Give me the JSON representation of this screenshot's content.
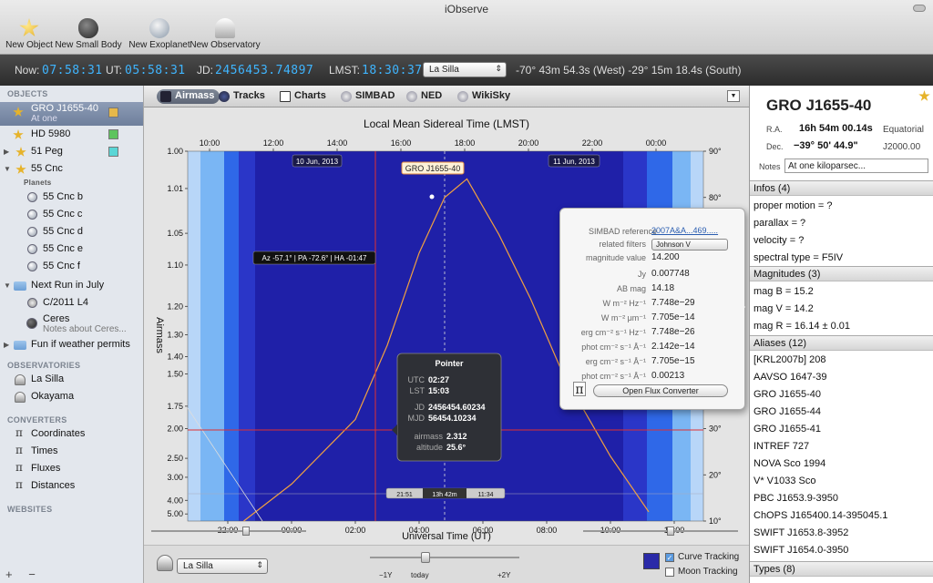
{
  "window": {
    "title": "iObserve"
  },
  "toolbar": {
    "new_object": "New Object",
    "new_small_body": "New Small Body",
    "new_exoplanet": "New Exoplanet",
    "new_observatory": "New Observatory"
  },
  "timebar": {
    "now_label": "Now:",
    "now_value": "07:58:31",
    "ut_label": "UT:",
    "ut_value": "05:58:31",
    "jd_label": "JD:",
    "jd_value": "2456453.74897",
    "lmst_label": "LMST:",
    "lmst_value": "18:30:37",
    "site": "La Silla",
    "site_coords": "-70° 43m 54.3s (West) -29° 15m 18.4s (South)"
  },
  "sidebar": {
    "objects_header": "OBJECTS",
    "selected": {
      "name": "GRO J1655-40",
      "subtitle": "At one"
    },
    "hd5980": "HD 5980",
    "peg51": "51 Peg",
    "cnc55": "55 Cnc",
    "planets_label": "Planets",
    "planets": [
      "55 Cnc b",
      "55 Cnc c",
      "55 Cnc d",
      "55 Cnc e",
      "55 Cnc f"
    ],
    "next_run": "Next Run in July",
    "c2011": "C/2011 L4",
    "ceres": "Ceres",
    "ceres_note": "Notes about Ceres...",
    "fun": "Fun if weather permits",
    "observatories_header": "OBSERVATORIES",
    "observatories": [
      "La Silla",
      "Okayama"
    ],
    "converters_header": "CONVERTERS",
    "converters": [
      "Coordinates",
      "Times",
      "Fluxes",
      "Distances"
    ],
    "websites_header": "WEBSITES",
    "add": "+",
    "remove": "−",
    "colors": {
      "gro": "#e6b84a",
      "hd": "#5ec45e",
      "peg": "#5ad6d6"
    }
  },
  "tabs": {
    "airmass": "Airmass",
    "tracks": "Tracks",
    "charts": "Charts",
    "simbad": "SIMBAD",
    "ned": "NED",
    "wikisky": "WikiSky",
    "menu": "▼"
  },
  "chart_data": {
    "type": "line",
    "title": "Local Mean Sidereal Time (LMST)",
    "xlabel": "Universal Time (UT)",
    "ylabel": "Airmass",
    "top_ticks": [
      "10:00",
      "12:00",
      "14:00",
      "16:00",
      "18:00",
      "20:00",
      "22:00",
      "00:00"
    ],
    "bottom_ticks": [
      "22:00",
      "00:00",
      "02:00",
      "04:00",
      "06:00",
      "08:00",
      "10:00",
      "12:00"
    ],
    "left_ticks": [
      "1.00",
      "1.01",
      "1.05",
      "1.10",
      "1.20",
      "1.30",
      "1.40",
      "1.50",
      "1.75",
      "2.00",
      "2.50",
      "3.00",
      "4.00",
      "5.00"
    ],
    "right_ticks": [
      "90°",
      "80°",
      "70°",
      "60°",
      "50°",
      "40°",
      "30°",
      "20°",
      "10°"
    ],
    "ylim": [
      10,
      90
    ],
    "series": [
      {
        "name": "GRO J1655-40",
        "color": "#f0a040",
        "x_hours": [
          22.5,
          0,
          2,
          3,
          4,
          4.8,
          5.5,
          6.5,
          7.5,
          8.5,
          10,
          11.2
        ],
        "altitude": [
          10,
          18,
          32,
          48,
          68,
          80,
          84,
          72,
          58,
          42,
          24,
          12
        ]
      }
    ],
    "date_labels": [
      "10 Jun, 2013",
      "11 Jun, 2013"
    ],
    "object_label": "GRO J1655-40",
    "cursor_label": "Az -57.1° | PA -72.6° | HA -01:47",
    "timeline_labels": [
      "21:51",
      "13h 42m",
      "11:34"
    ],
    "colors": {
      "night": "#1f20a8",
      "twilight_deep": "#2a36c8",
      "twilight_mid": "#2f68e8",
      "twilight_light": "#7ab6f4",
      "day": "#b8d6f8",
      "cursor": "#e03030"
    }
  },
  "pointer": {
    "title": "Pointer",
    "utc_label": "UTC",
    "utc": "02:27",
    "lst_label": "LST",
    "lst": "15:03",
    "jd_label": "JD",
    "jd": "2456454.60234",
    "mjd_label": "MJD",
    "mjd": "56454.10234",
    "airmass_label": "airmass",
    "airmass": "2.312",
    "altitude_label": "altitude",
    "altitude": "25.6°"
  },
  "flux_popup": {
    "simbad_label": "SIMBAD reference",
    "simbad_value": "2007A&A...469.....",
    "filters_label": "related filters",
    "filters_value": "Johnson V",
    "mag_label": "magnitude value",
    "mag_value": "14.200",
    "rows": [
      {
        "l": "Jy",
        "v": "0.007748"
      },
      {
        "l": "AB mag",
        "v": "14.18"
      },
      {
        "l": "W m⁻² Hz⁻¹",
        "v": "7.748e−29"
      },
      {
        "l": "W m⁻² μm⁻¹",
        "v": "7.705e−14"
      },
      {
        "l": "erg cm⁻² s⁻¹ Hz⁻¹",
        "v": "7.748e−26"
      },
      {
        "l": "phot cm⁻² s⁻¹ Å⁻¹",
        "v": "2.142e−14"
      },
      {
        "l": "erg cm⁻² s⁻¹ Å⁻¹",
        "v": "7.705e−15"
      },
      {
        "l": "phot cm⁻² s⁻¹ Å⁻¹",
        "v": "0.00213"
      }
    ],
    "button": "Open Flux Converter",
    "pi": "π"
  },
  "bottom": {
    "site": "La Silla",
    "minus": "−1Y",
    "today": "today",
    "plus": "+2Y",
    "curve_tracking": "Curve Tracking",
    "moon_tracking": "Moon Tracking"
  },
  "right": {
    "title": "GRO J1655-40",
    "ra_label": "R.A.",
    "ra": "16h 54m 00.14s",
    "dec_label": "Dec.",
    "dec": "−39° 50' 44.9\"",
    "system": "Equatorial",
    "epoch": "J2000.00",
    "notes_label": "Notes",
    "notes": "At one kiloparsec...",
    "infos_header": "Infos (4)",
    "infos": [
      "proper motion = ?",
      "parallax = ?",
      "velocity = ?",
      "spectral type = F5IV"
    ],
    "mags_header": "Magnitudes (3)",
    "mags": [
      "mag B = 15.2",
      "mag V = 14.2",
      "mag R = 16.14 ± 0.01"
    ],
    "aliases_header": "Aliases (12)",
    "aliases": [
      "[KRL2007b] 208",
      "AAVSO 1647-39",
      "GRO J1655-40",
      "GRO J1655-44",
      "GRO J1655-41",
      "INTREF   727",
      "NOVA Sco 1994",
      "V* V1033 Sco",
      "PBC J1653.9-3950",
      "ChOPS J165400.14-395045.1",
      "SWIFT J1653.8-3952",
      "SWIFT J1654.0-3950"
    ],
    "types_header": "Types (8)"
  }
}
